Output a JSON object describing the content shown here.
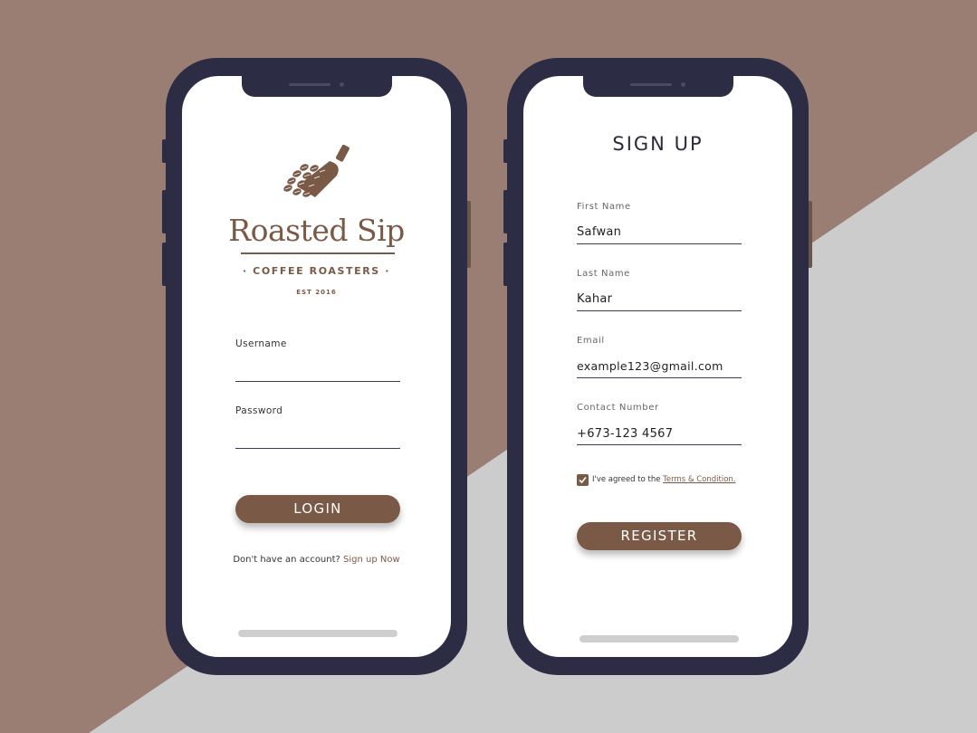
{
  "colors": {
    "brand": "#7a5a47",
    "phone_frame": "#2c2c45",
    "background_top": "#9a7d73",
    "background_bottom": "#cccccc"
  },
  "login_screen": {
    "logo_icon": "coffee-scoop-icon",
    "brand_name": "Roasted Sip",
    "tagline": "· COFFEE ROASTERS ·",
    "established": "EST 2016",
    "username_label": "Username",
    "username_value": "",
    "password_label": "Password",
    "password_value": "",
    "login_button": "LOGIN",
    "signup_prompt": "Don't have an account?",
    "signup_link": "Sign up Now"
  },
  "signup_screen": {
    "title": "SIGN UP",
    "fields": [
      {
        "label": "First Name",
        "value": "Safwan"
      },
      {
        "label": "Last Name",
        "value": "Kahar"
      },
      {
        "label": "Email",
        "value": "example123@gmail.com"
      },
      {
        "label": "Contact Number",
        "value": "+673-123 4567"
      }
    ],
    "terms_checked": true,
    "agree_text": "I've agreed to the",
    "terms_link": "Terms & Condition.",
    "register_button": "REGISTER"
  }
}
